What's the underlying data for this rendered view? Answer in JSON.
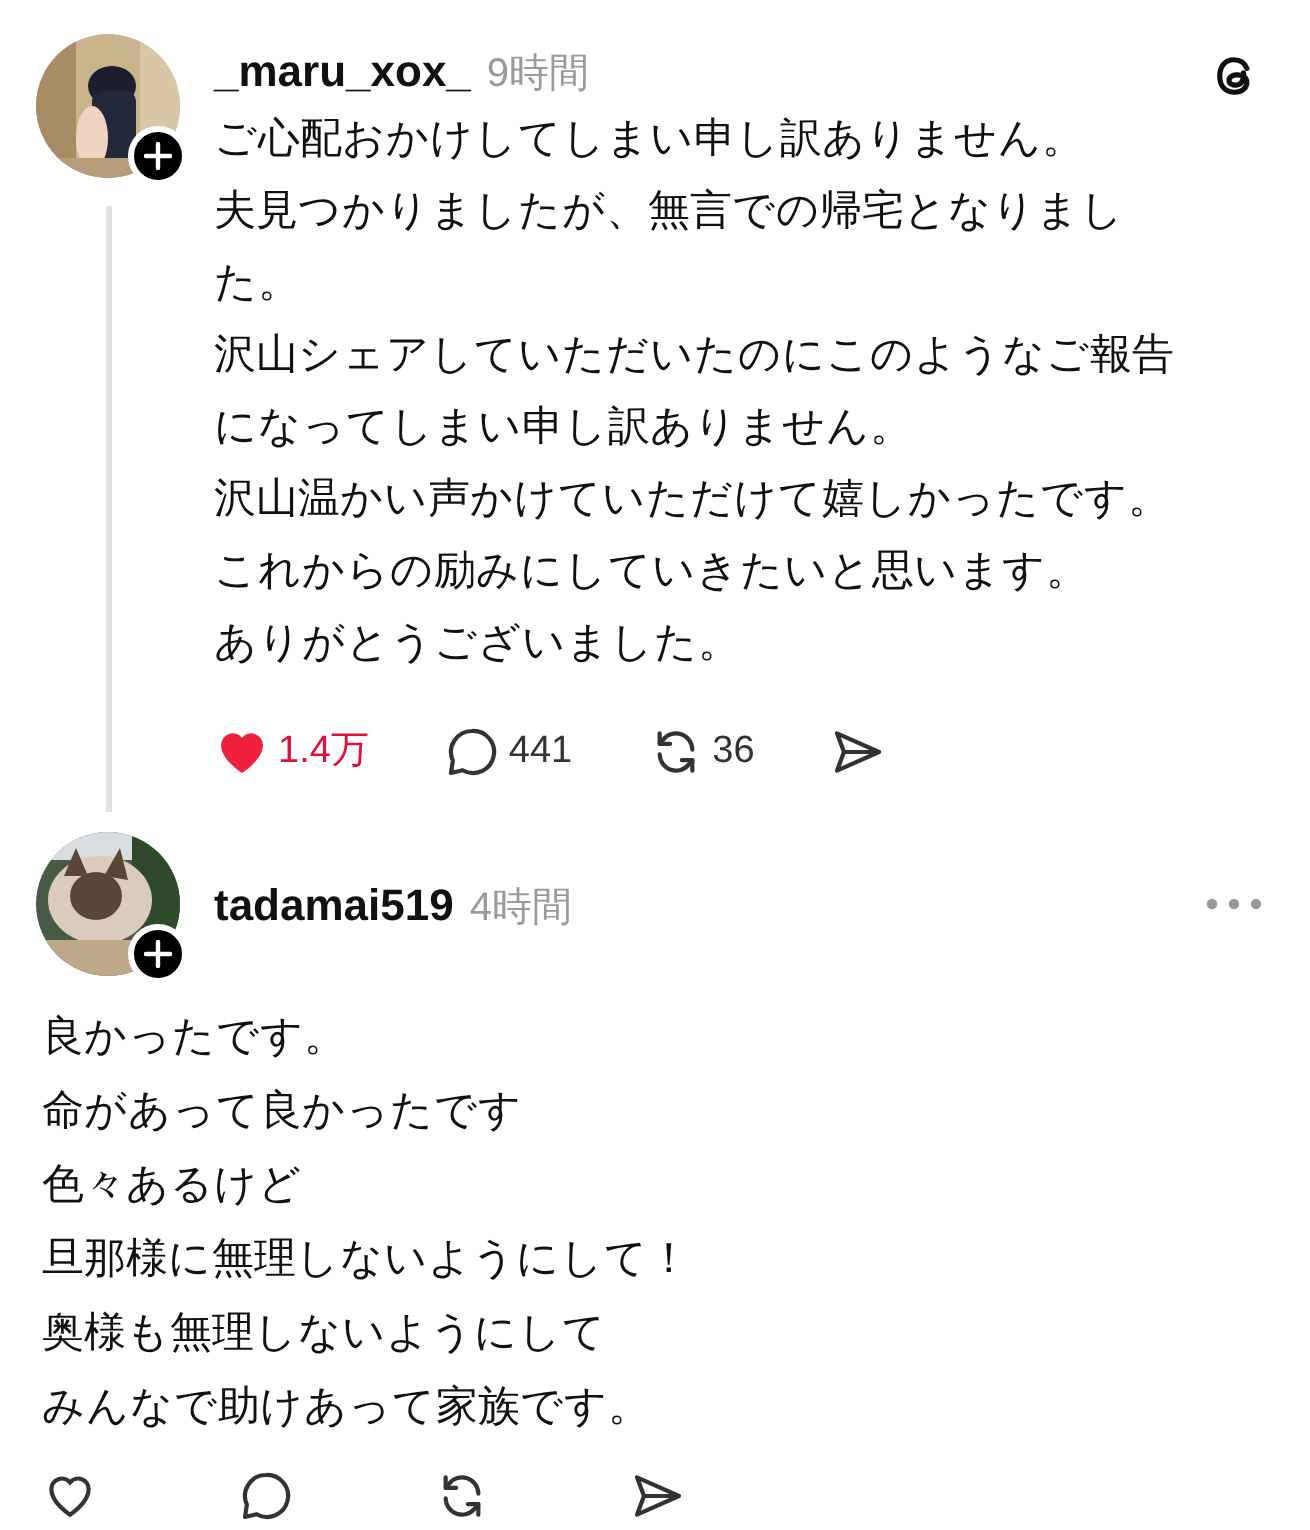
{
  "posts": [
    {
      "kind": "thread",
      "username": "_maru_xox_",
      "time": "9時間",
      "lines": [
        "ご心配おかけしてしまい申し訳ありません。",
        "夫見つかりましたが、無言での帰宅となりまし",
        "た。",
        "沢山シェアしていただいたのにこのようなご報告",
        "になってしまい申し訳ありません。",
        "沢山温かい声かけていただけて嬉しかったです。",
        "これからの励みにしていきたいと思います。",
        "ありがとうございました。"
      ],
      "actions": {
        "liked": true,
        "likes": "1.4万",
        "replies": "441",
        "reposts": "36"
      }
    },
    {
      "kind": "reply",
      "username": "tadamai519",
      "time": "4時間",
      "lines": [
        "良かったです。",
        "命があって良かったです",
        "色々あるけど",
        "旦那様に無理しないようにして！",
        "奥様も無理しないようにして",
        "みんなで助けあって家族です。"
      ],
      "actions": {
        "liked": false
      }
    }
  ]
}
